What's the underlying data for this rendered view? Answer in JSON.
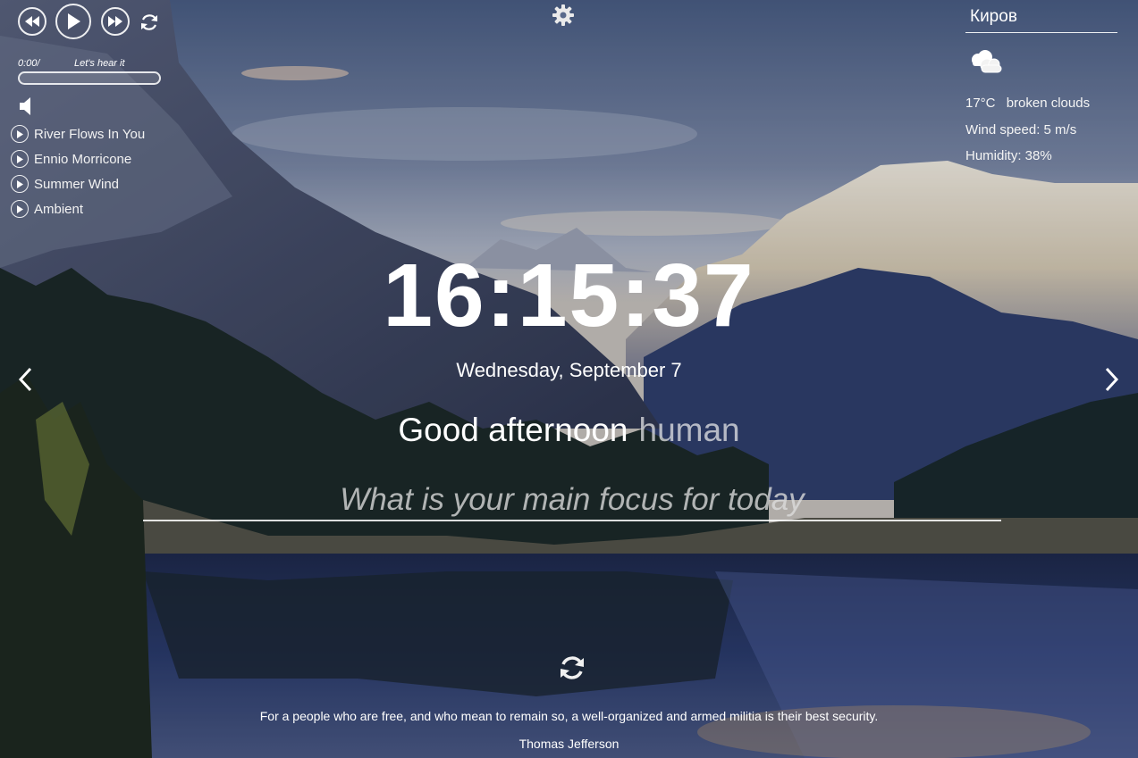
{
  "player": {
    "time": "0:00/",
    "track_title": "Let's hear it",
    "progress": 0,
    "playlist": [
      {
        "label": "River Flows In You"
      },
      {
        "label": "Ennio Morricone"
      },
      {
        "label": "Summer Wind"
      },
      {
        "label": "Ambient"
      }
    ]
  },
  "weather": {
    "city": "Киров",
    "icon": "broken-clouds-icon",
    "temperature": "17°C",
    "description": "broken clouds",
    "wind": "Wind speed: 5 m/s",
    "humidity": "Humidity: 38%"
  },
  "clock": {
    "time": "16:15:37",
    "date": "Wednesday, September 7"
  },
  "greeting": {
    "text": "Good afternoon",
    "name": "human"
  },
  "focus": {
    "placeholder": "What is your main focus for today"
  },
  "quote": {
    "text": "For a people who are free, and who mean to remain so, a well-organized and armed militia is their best security.",
    "author": "Thomas Jefferson"
  },
  "icons": {
    "settings": "gear-icon",
    "prev_bg": "chevron-left-icon",
    "next_bg": "chevron-right-icon",
    "quote_refresh": "refresh-icon"
  },
  "colors": {
    "text": "#ffffff",
    "muted_text": "#d9d9d9"
  }
}
